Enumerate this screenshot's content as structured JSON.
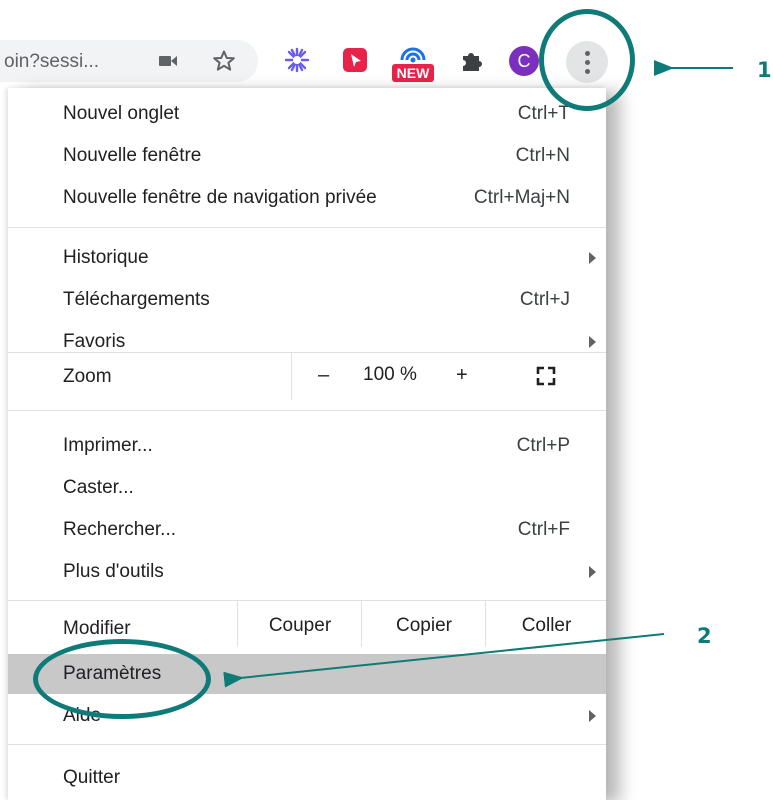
{
  "toolbar": {
    "url_fragment": "oin?sessi...",
    "icons": [
      "video-camera-icon",
      "star-icon",
      "asterisk-extension-icon",
      "cursor-extension-icon",
      "new-badge-extension-icon",
      "puzzle-extensions-icon",
      "profile-avatar"
    ],
    "new_badge": "NEW",
    "avatar_letter": "C",
    "avatar_color": "#7b2fbf"
  },
  "menu": {
    "group1": [
      {
        "label": "Nouvel onglet",
        "shortcut": "Ctrl+T"
      },
      {
        "label": "Nouvelle fenêtre",
        "shortcut": "Ctrl+N"
      },
      {
        "label": "Nouvelle fenêtre de navigation privée",
        "shortcut": "Ctrl+Maj+N"
      }
    ],
    "group2": [
      {
        "label": "Historique",
        "shortcut": ""
      },
      {
        "label": "Téléchargements",
        "shortcut": "Ctrl+J"
      },
      {
        "label": "Favoris",
        "shortcut": ""
      }
    ],
    "zoom": {
      "label": "Zoom",
      "minus": "–",
      "value": "100 %",
      "plus": "+"
    },
    "group3": [
      {
        "label": "Imprimer...",
        "shortcut": "Ctrl+P"
      },
      {
        "label": "Caster...",
        "shortcut": ""
      },
      {
        "label": "Rechercher...",
        "shortcut": "Ctrl+F"
      },
      {
        "label": "Plus d'outils",
        "shortcut": ""
      }
    ],
    "edit": {
      "label": "Modifier",
      "cut": "Couper",
      "copy": "Copier",
      "paste": "Coller"
    },
    "group4": [
      {
        "label": "Paramètres",
        "highlighted": true
      },
      {
        "label": "Aide",
        "shortcut": ""
      }
    ],
    "quit": {
      "label": "Quitter"
    }
  },
  "annotations": {
    "marker1": "1",
    "marker2": "2",
    "color": "#0e7b78"
  }
}
